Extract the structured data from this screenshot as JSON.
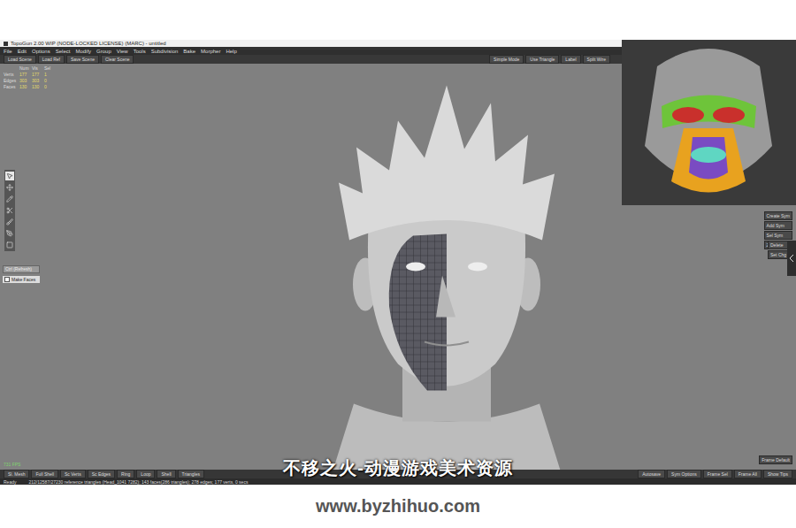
{
  "window": {
    "title": "TopoGun 2.00 WIP (NODE-LOCKED LICENSE) (MARC) - untitled"
  },
  "menu": [
    "File",
    "Edit",
    "Options",
    "Select",
    "Modify",
    "Group",
    "View",
    "Tools",
    "Subdivision",
    "Bake",
    "Morpher",
    "Help"
  ],
  "toolbar": {
    "left": [
      "Load Scene",
      "Load Ref",
      "Save Scene",
      "Clear Scene"
    ],
    "right": [
      "Simple Mode",
      "Use Triangle",
      "Label",
      "Split Wire"
    ]
  },
  "stats": {
    "columns": [
      "Num",
      "Vis",
      "Sel"
    ],
    "rows": [
      {
        "label": "Verts",
        "values": [
          "177",
          "177",
          "1"
        ]
      },
      {
        "label": "Edges",
        "values": [
          "303",
          "303",
          "0"
        ]
      },
      {
        "label": "Faces",
        "values": [
          "130",
          "130",
          "0"
        ]
      }
    ]
  },
  "tools": [
    {
      "kind": "select",
      "selected": true
    },
    {
      "kind": "move",
      "selected": false
    },
    {
      "kind": "draw",
      "selected": false
    },
    {
      "kind": "cut",
      "selected": false
    },
    {
      "kind": "brush",
      "selected": false
    },
    {
      "kind": "pen",
      "selected": false
    },
    {
      "kind": "box",
      "selected": false
    }
  ],
  "tool_panel": {
    "field": "Ctrl (Refresh)",
    "checkbox": {
      "label": "Make Faces",
      "checked": false
    }
  },
  "symmetry_buttons": [
    "Create Sym",
    "Add Sym",
    "Sel Sym",
    "Zero Sym"
  ],
  "side_buttons": [
    "Delete",
    "Set Chg"
  ],
  "frame_button": "Frame Default",
  "fps": "731 FPS",
  "bottom_buttons": {
    "left": [
      "Sl. Mesh",
      "Full Shell",
      "Sc Verts",
      "Sc Edges",
      "Ring",
      "Loop",
      "Shell",
      "Triangles"
    ],
    "right": [
      "Autosave",
      "Sym Options",
      "Frame Sel",
      "Frame All",
      "Show Tips"
    ]
  },
  "status": {
    "state": "Ready",
    "info": "212/12587/27230 reference triangles (Head_1041 7282); 143 faces(286 triangles); 278 edges; 177 verts, 0 secs"
  },
  "watermark": "不移之火-动漫游戏美术资源",
  "url": "www.byzhihuo.com"
}
